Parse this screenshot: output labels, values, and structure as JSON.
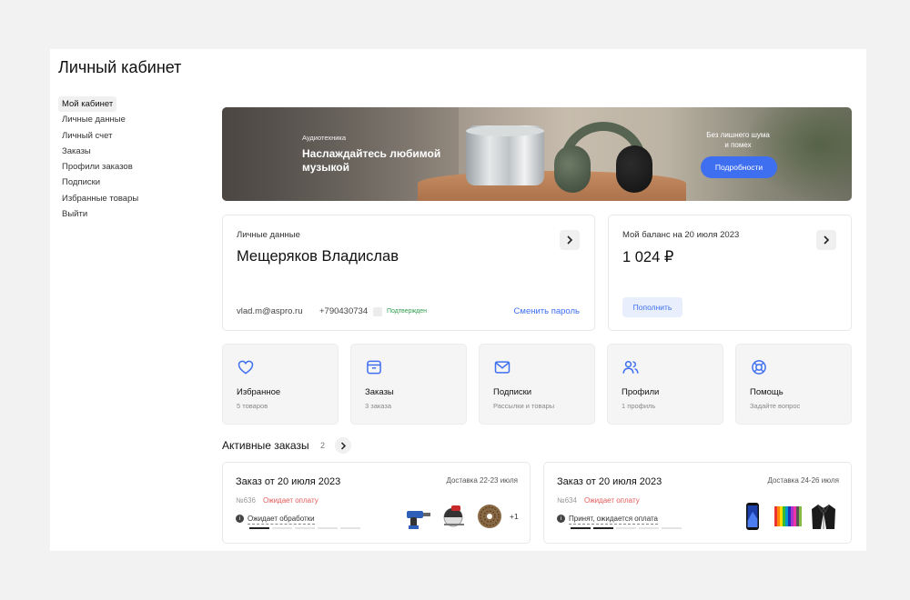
{
  "page": {
    "title": "Личный кабинет"
  },
  "sidebar": {
    "items": [
      {
        "label": "Мой кабинет",
        "active": true
      },
      {
        "label": "Личные данные"
      },
      {
        "label": "Личный счет"
      },
      {
        "label": "Заказы"
      },
      {
        "label": "Профили заказов"
      },
      {
        "label": "Подписки"
      },
      {
        "label": "Избранные товары"
      },
      {
        "label": "Выйти"
      }
    ]
  },
  "banner": {
    "subtitle": "Аудиотехника",
    "title": "Наслаждайтесь любимой музыкой",
    "side_text": "Без лишнего шума и помех",
    "button": "Подробности"
  },
  "personal": {
    "label": "Личные данные",
    "name": "Мещеряков Владислав",
    "email": "vlad.m@aspro.ru",
    "phone": "+790430734",
    "phone_status": "Подтвержден",
    "change_password": "Сменить пароль"
  },
  "balance": {
    "label": "Мой баланс на 20 июля 2023",
    "value": "1 024 ₽",
    "button": "Пополнить"
  },
  "tiles": [
    {
      "title": "Избранное",
      "subtitle": "5 товаров",
      "icon": "heart-icon"
    },
    {
      "title": "Заказы",
      "subtitle": "3 заказа",
      "icon": "box-icon"
    },
    {
      "title": "Подписки",
      "subtitle": "Рассылки и товары",
      "icon": "mail-icon"
    },
    {
      "title": "Профили",
      "subtitle": "1 профиль",
      "icon": "users-icon"
    },
    {
      "title": "Помощь",
      "subtitle": "Задайте вопрос",
      "icon": "lifebuoy-icon"
    }
  ],
  "orders_section": {
    "title": "Активные заказы",
    "count": "2"
  },
  "orders": [
    {
      "title": "Заказ от 20 июля 2023",
      "delivery": "Доставка 22-23 июля",
      "number": "№636",
      "payment": "Ожидает оплату",
      "status": "Ожидает обработки",
      "progress_done": 1,
      "progress_total": 5,
      "more": "+1",
      "items": [
        "drill-icon",
        "saw-icon",
        "nails-icon"
      ]
    },
    {
      "title": "Заказ от 20 июля 2023",
      "delivery": "Доставка 24-26 июля",
      "number": "№634",
      "payment": "Ожидает оплату",
      "status": "Принят, ожидается оплата",
      "progress_done": 2,
      "progress_total": 5,
      "more": "",
      "items": [
        "phone-icon",
        "pencils-icon",
        "jacket-icon"
      ]
    }
  ],
  "colors": {
    "accent": "#3e6ff0",
    "success": "#2f9d4f",
    "warning": "#e35a5a"
  }
}
